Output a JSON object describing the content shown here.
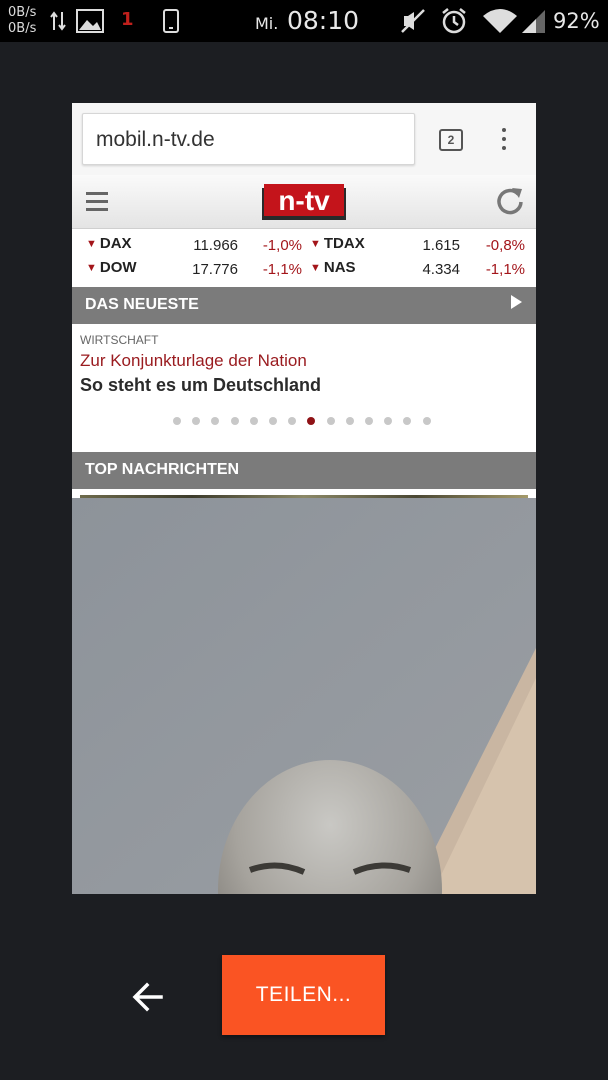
{
  "status_bar": {
    "net_up": "0B/s",
    "net_down": "0B/s",
    "notification_count": "1",
    "day": "Mi.",
    "time": "08:10",
    "battery": "92%",
    "icons": [
      "data-transfer-icon",
      "gallery-icon",
      "notification-icon",
      "phone-icon",
      "mute-icon",
      "alarm-icon",
      "wifi-icon",
      "signal-icon"
    ]
  },
  "browser": {
    "url": "mobil.n-tv.de",
    "tab_count": "2"
  },
  "site": {
    "logo_text": "n-tv",
    "ticker": [
      {
        "name": "DAX",
        "value": "11.966",
        "change": "-1,0%"
      },
      {
        "name": "TDAX",
        "value": "1.615",
        "change": "-0,8%"
      },
      {
        "name": "DOW",
        "value": "17.776",
        "change": "-1,1%"
      },
      {
        "name": "NAS",
        "value": "4.334",
        "change": "-1,1%"
      }
    ],
    "latest": {
      "title": "DAS NEUESTE",
      "kicker": "WIRTSCHAFT",
      "headline_red": "Zur Konjunkturlage der Nation",
      "headline": "So steht es um Deutschland",
      "carousel_total": 14,
      "carousel_active": 7
    },
    "top_news": {
      "title": "TOP NACHRICHTEN"
    }
  },
  "actions": {
    "share_label": "TEILEN..."
  },
  "colors": {
    "accent": "#fa5423",
    "ntv_red": "#a3151a",
    "section_grey": "#7b7b7b"
  }
}
